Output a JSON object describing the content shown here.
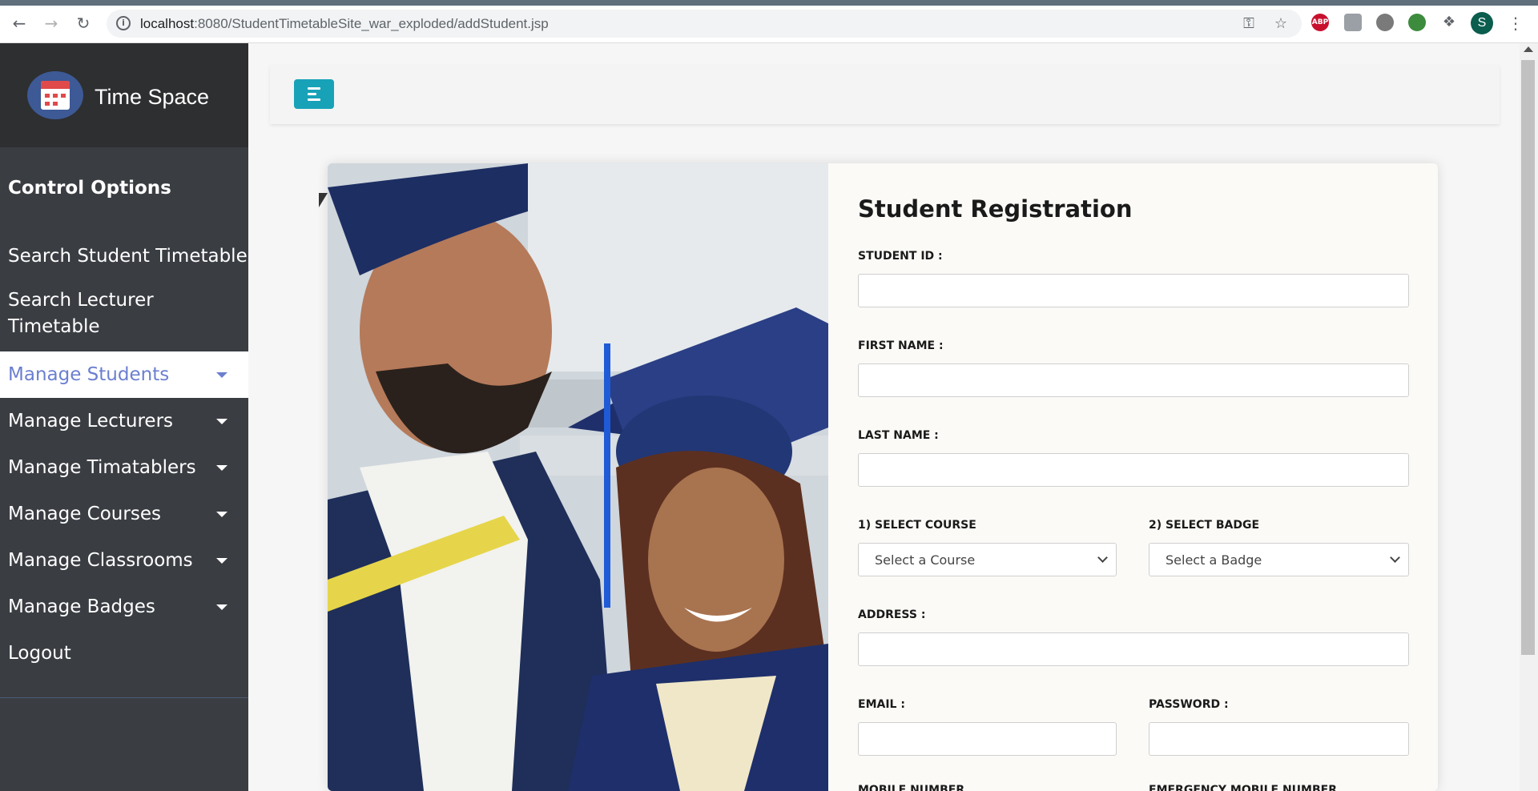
{
  "browser": {
    "url_host": "localhost",
    "url_path": ":8080/StudentTimetableSite_war_exploded/addStudent.jsp",
    "profile_initial": "S",
    "ext_abp_label": "ABP"
  },
  "brand": {
    "name": "Time Space"
  },
  "sidebar": {
    "heading": "Control Options",
    "items": [
      {
        "label": "Search Student Timetable"
      },
      {
        "label": "Search Lecturer Timetable"
      },
      {
        "label": "Manage Students"
      },
      {
        "label": "Manage Lecturers"
      },
      {
        "label": "Manage Timatablers"
      },
      {
        "label": "Manage Courses"
      },
      {
        "label": "Manage Classrooms"
      },
      {
        "label": "Manage Badges"
      },
      {
        "label": "Logout"
      }
    ]
  },
  "form": {
    "title": "Student Registration",
    "student_id_label": "STUDENT ID :",
    "first_name_label": "FIRST NAME :",
    "last_name_label": "LAST NAME :",
    "course_label": "1) SELECT COURSE",
    "course_selected": "Select a Course",
    "badge_label": "2) SELECT BADGE",
    "badge_selected": "Select a Badge",
    "address_label": "ADDRESS :",
    "email_label": "EMAIL :",
    "password_label": "PASSWORD :",
    "mobile_label": "MOBILE NUMBER",
    "emergency_label": "EMERGENCY MOBILE NUMBER"
  },
  "colors": {
    "sidebar_bg": "#3a3d42",
    "brand_bg": "#2e2f31",
    "active_text": "#6b7fd0",
    "toggle_button": "#17a2b8"
  }
}
